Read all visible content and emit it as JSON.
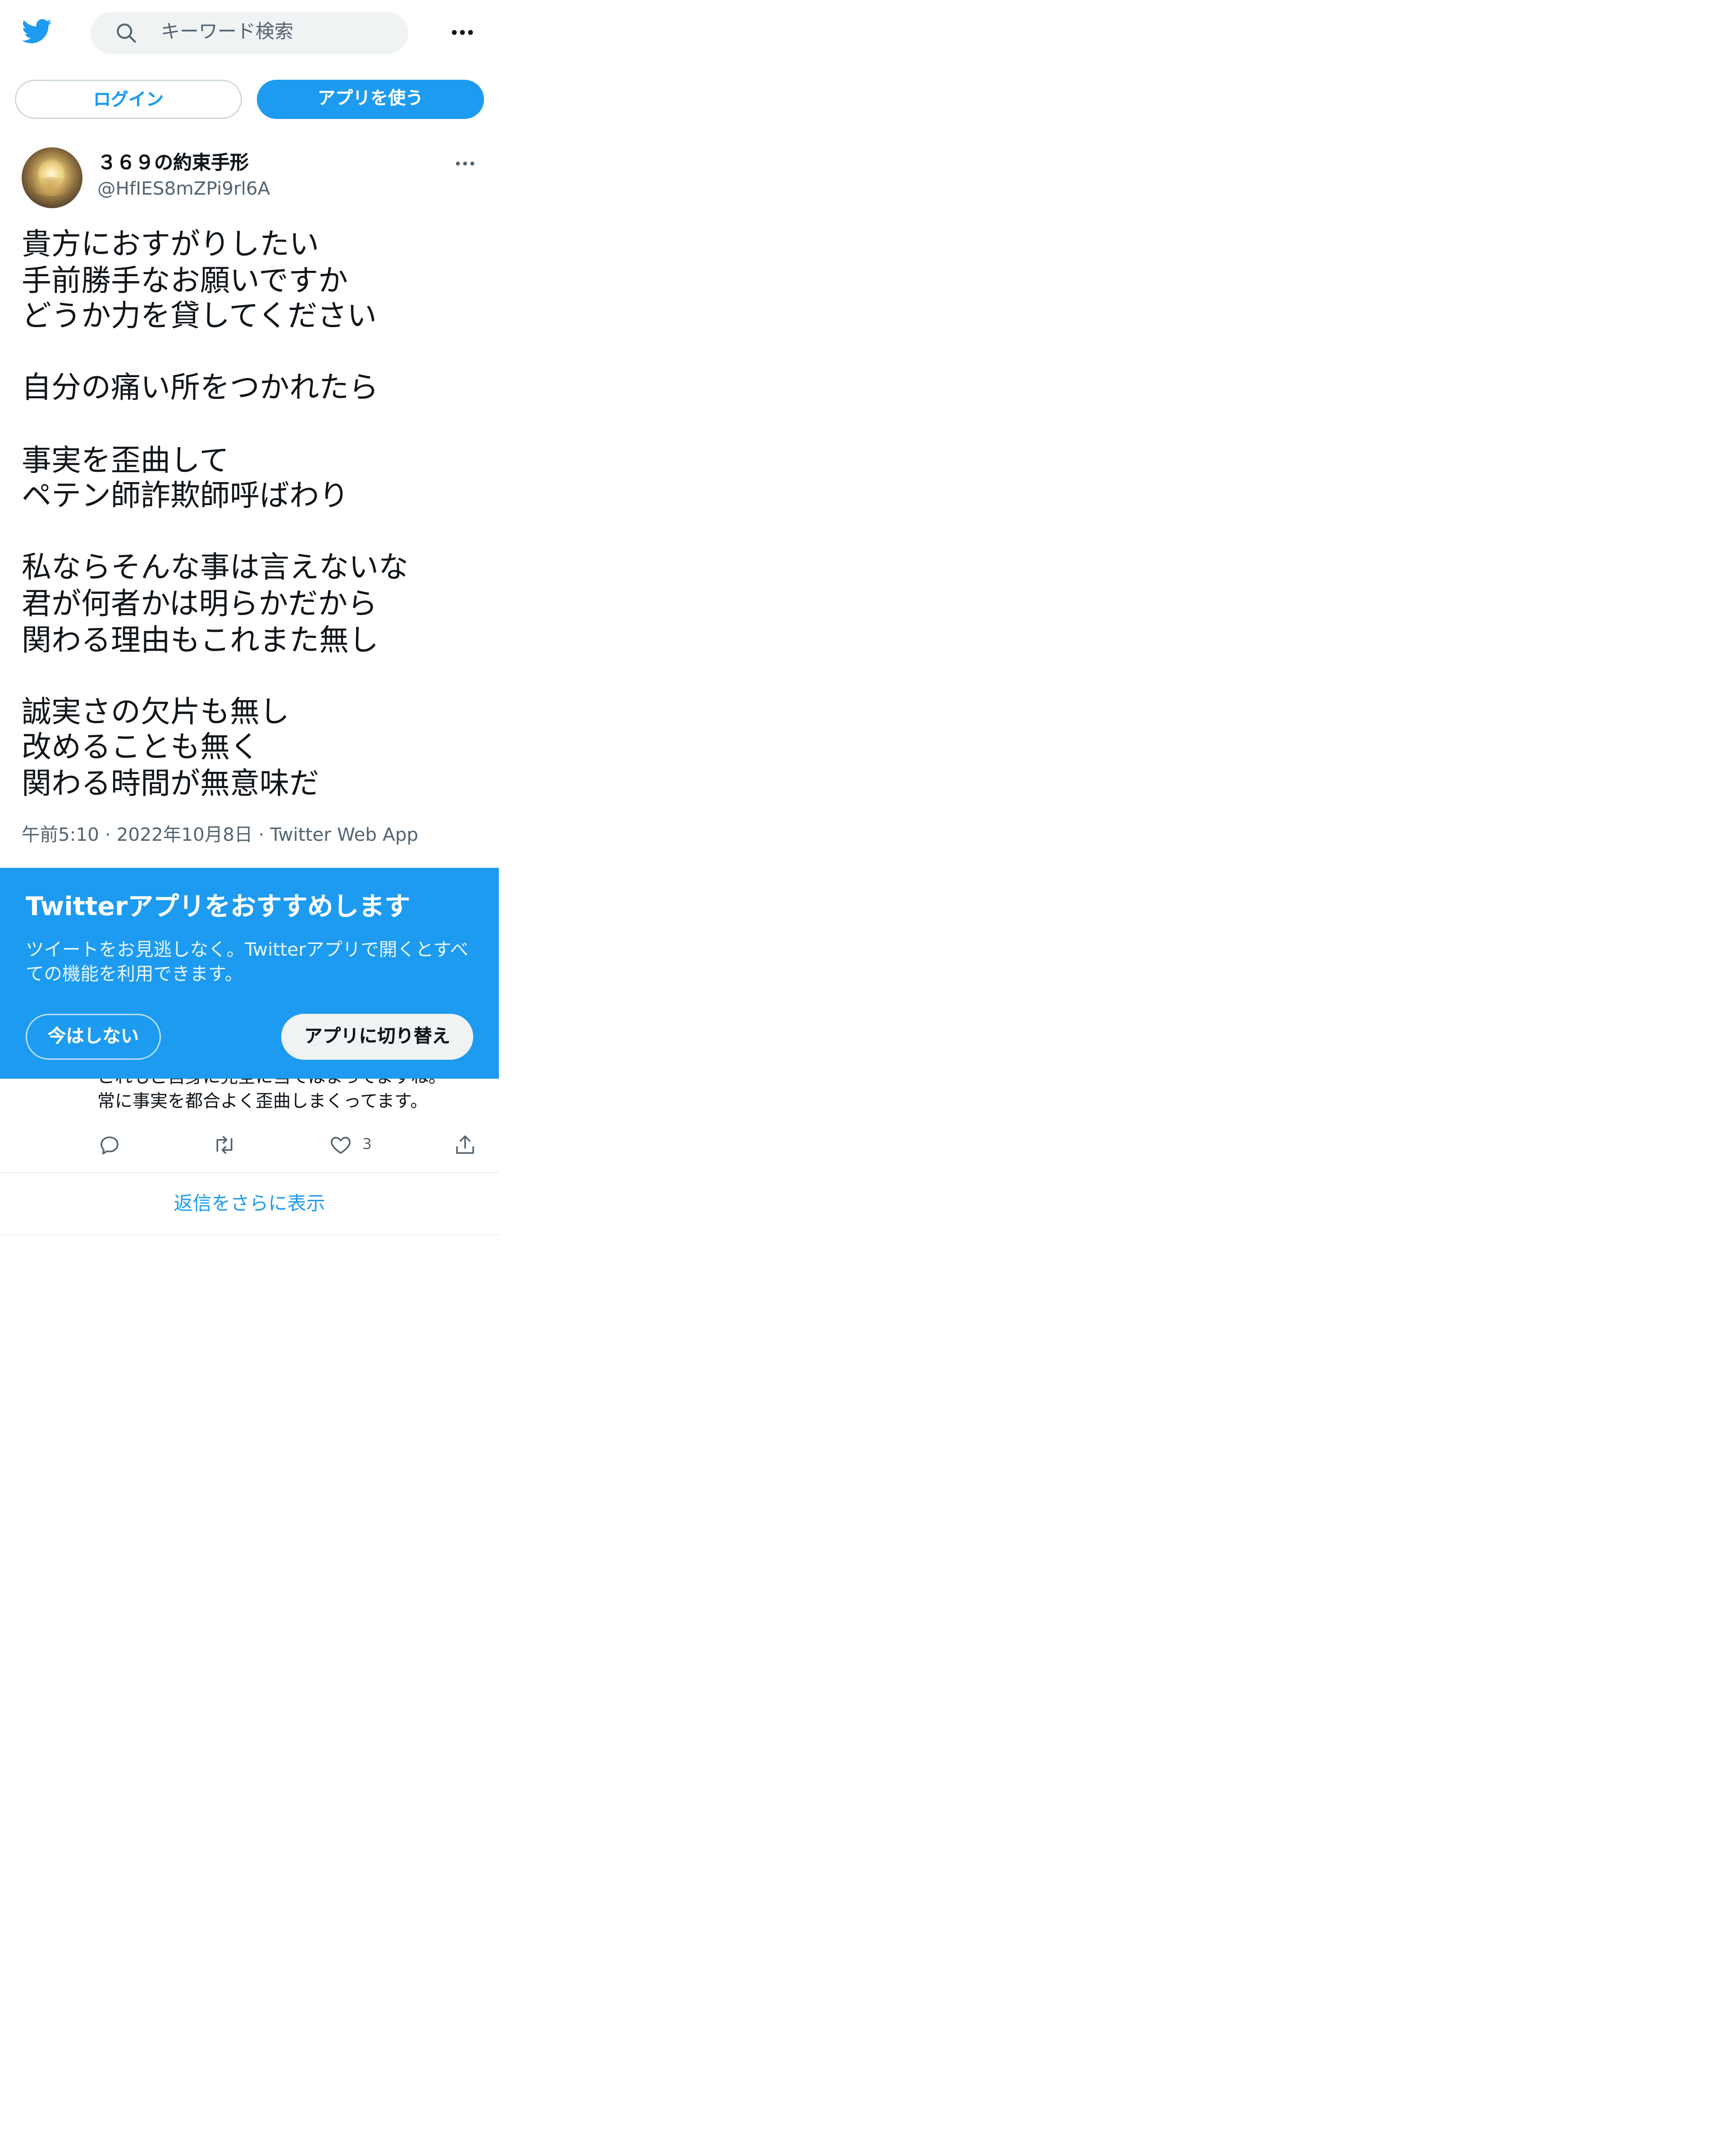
{
  "colors": {
    "brand": "#1d9bf0",
    "text": "#0f1419",
    "muted": "#536471"
  },
  "header": {
    "search_placeholder": "キーワード検索",
    "login_label": "ログイン",
    "use_app_label": "アプリを使う"
  },
  "tweet": {
    "display_name": "３６９の約束手形",
    "handle": "@HfIES8mZPi9rl6A",
    "text": "貴方におすがりしたい\n手前勝手なお願いですか\nどうか力を貸してください\n\n自分の痛い所をつかれたら\n\n事実を歪曲して\nペテン師詐欺師呼ばわり\n\n私ならそんな事は言えないな\n君が何者かは明らかだから\n関わる理由もこれまた無し\n\n誠実さの欠片も無し\n改めることも無く\n関わる時間が無意味だ",
    "time": "午前5:10",
    "date": "2022年10月8日",
    "client": "Twitter Web App",
    "separator": "·"
  },
  "reply": {
    "text": "これもご自身に完全に当てはまってますね。\n常に事実を都合よく歪曲しまくってます。",
    "like_count": "3"
  },
  "show_more_replies": "返信をさらに表示",
  "app_banner": {
    "title": "Twitterアプリをおすすめします",
    "description": "ツイートをお見逃しなく。Twitterアプリで開くとすべての機能を利用できます。",
    "not_now": "今はしない",
    "switch": "アプリに切り替え"
  }
}
